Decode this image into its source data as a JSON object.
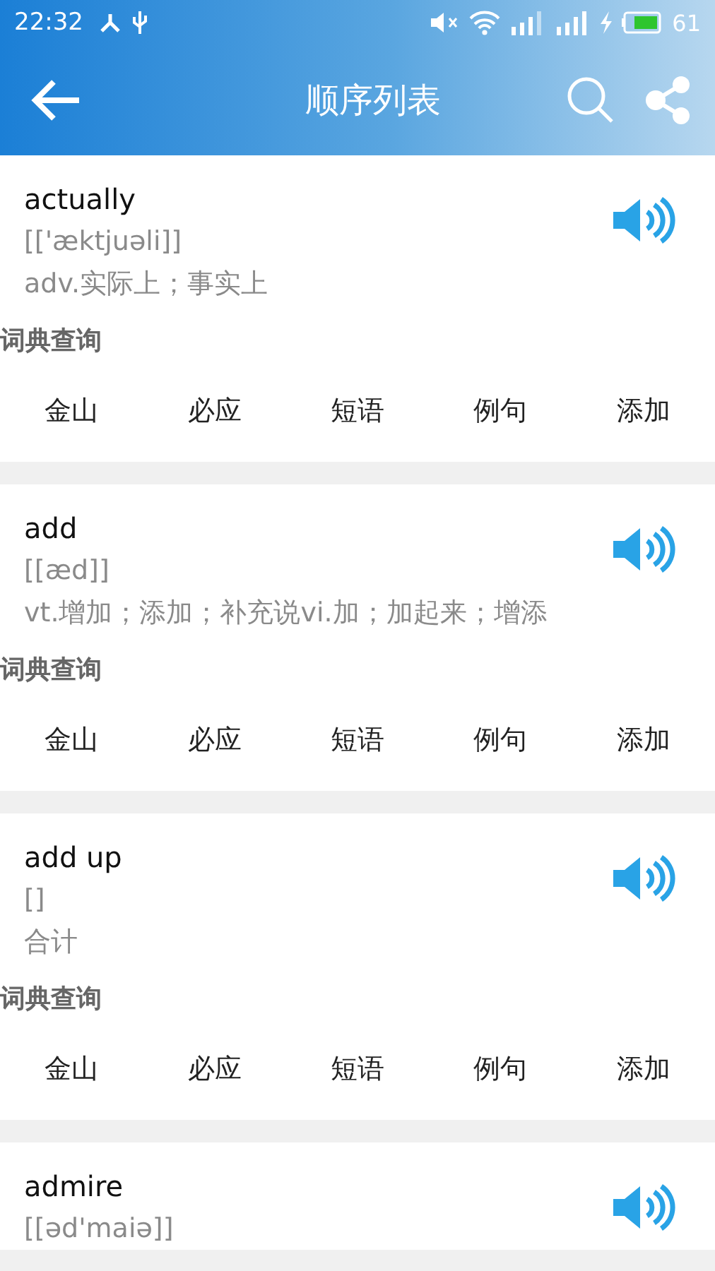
{
  "status_bar": {
    "time": "22:32",
    "battery": "61"
  },
  "header": {
    "title": "顺序列表"
  },
  "entries": [
    {
      "word": "actually",
      "phonetic": "[['æktjuəli]]",
      "meaning": "adv.实际上；事实上",
      "section_label": "词典查询",
      "actions": [
        "金山",
        "必应",
        "短语",
        "例句",
        "添加"
      ]
    },
    {
      "word": "add",
      "phonetic": "[[æd]]",
      "meaning": "vt.增加；添加；补充说vi.加；加起来；增添",
      "section_label": "词典查询",
      "actions": [
        "金山",
        "必应",
        "短语",
        "例句",
        "添加"
      ]
    },
    {
      "word": "add up",
      "phonetic": "[]",
      "meaning": "合计",
      "section_label": "词典查询",
      "actions": [
        "金山",
        "必应",
        "短语",
        "例句",
        "添加"
      ]
    },
    {
      "word": "admire",
      "phonetic": "[[əd'maiə]]"
    }
  ]
}
